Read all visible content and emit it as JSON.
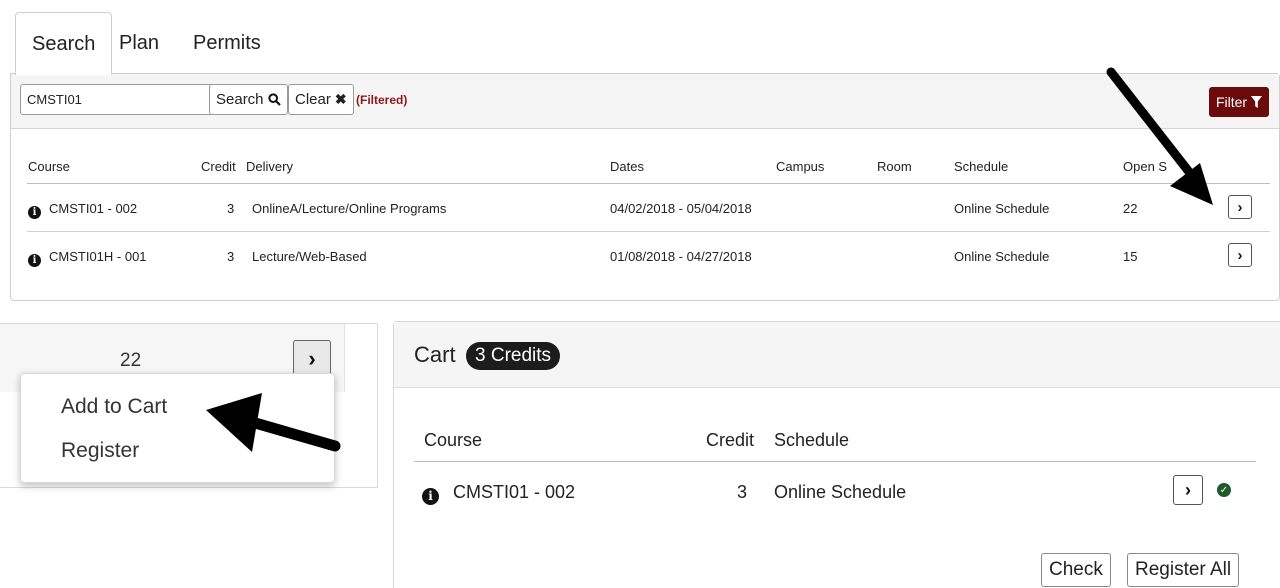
{
  "tabs": [
    {
      "label": "Search",
      "active": true
    },
    {
      "label": "Plan",
      "active": false
    },
    {
      "label": "Permits",
      "active": false
    }
  ],
  "search": {
    "value": "CMSTI01",
    "search_label": "Search",
    "clear_label": "Clear",
    "filtered_note": "(Filtered)",
    "filter_label": "Filter"
  },
  "results": {
    "headers": {
      "course": "Course",
      "credit": "Credit",
      "delivery": "Delivery",
      "dates": "Dates",
      "campus": "Campus",
      "room": "Room",
      "schedule": "Schedule",
      "open_seats": "Open S"
    },
    "rows": [
      {
        "course": "CMSTI01 - 002",
        "credit": "3",
        "delivery": "OnlineA/Lecture/Online Programs",
        "dates": "04/02/2018 - 05/04/2018",
        "campus": "",
        "room": "",
        "schedule": "Online Schedule",
        "open": "22"
      },
      {
        "course": "CMSTI01H - 001",
        "credit": "3",
        "delivery": "Lecture/Web-Based",
        "dates": "01/08/2018 - 04/27/2018",
        "campus": "",
        "room": "",
        "schedule": "Online Schedule",
        "open": "15"
      }
    ]
  },
  "zoom": {
    "open_seats": "22",
    "menu": [
      "Add to Cart",
      "Register"
    ]
  },
  "cart": {
    "title": "Cart",
    "badge": "3 Credits",
    "headers": {
      "course": "Course",
      "credit": "Credit",
      "schedule": "Schedule"
    },
    "row": {
      "course": "CMSTI01 - 002",
      "credit": "3",
      "schedule": "Online Schedule"
    },
    "check_label": "Check",
    "register_all_label": "Register All"
  },
  "colors": {
    "filter_button": "#6b0a0a",
    "filtered_note": "#8a1a1a",
    "status_ok": "#1f5a2a"
  },
  "icons": [
    "search-icon",
    "close-icon",
    "filter-icon",
    "info-icon",
    "chevron-right-icon",
    "check-circle-icon",
    "arrow-annotation"
  ]
}
